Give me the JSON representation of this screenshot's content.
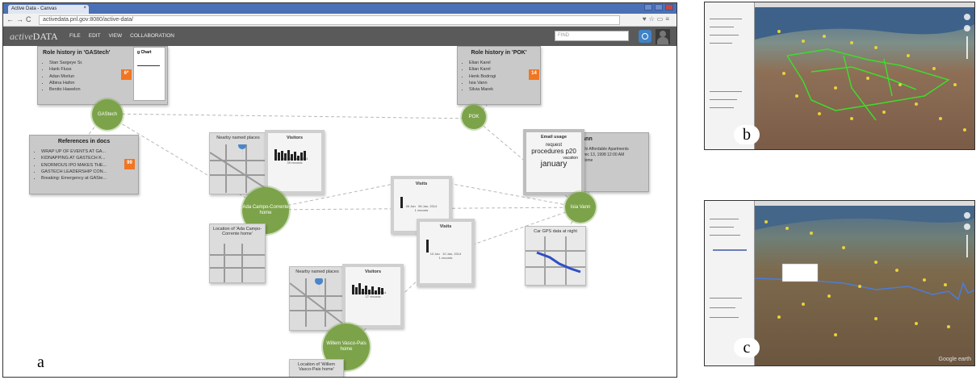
{
  "panel_a": {
    "label": "a",
    "browser": {
      "tab_title": "Active Data - Canvas",
      "url": "activedata.pnl.gov:8080/active-data/"
    },
    "app": {
      "logo_prefix": "active",
      "logo_suffix": "DATA",
      "menu": [
        "FILE",
        "EDIT",
        "VIEW",
        "COLLABORATION"
      ],
      "find_placeholder": "FIND"
    },
    "cards": {
      "role_gastech": {
        "title": "Role history in 'GAStech'",
        "items": [
          "Stan Sargeye Sr.",
          "Hank Fluss",
          "Adan Morlun",
          "Albina Hafon",
          "Benito Hawelon"
        ],
        "badge": "6*",
        "chart_title": "g Chart"
      },
      "role_pok": {
        "title": "Role history in 'POK'",
        "items": [
          "Elian Karel",
          "Elian Karel",
          "Henk Bodrogi",
          "Isia Vann",
          "Silvia Marek"
        ],
        "badge": "14"
      },
      "refs": {
        "title": "References in docs",
        "items": [
          "WRAP UP OF EVENTS AT GA...",
          "KIDNAPPING AT GASTECH K...",
          "ENORMOUS IPO MAKES THE...",
          "GASTECH LEADERSHIP CON...",
          "Breaking: Emergency at GASte..."
        ],
        "badge": "99"
      },
      "isia": {
        "title": "Vann",
        "lines": [
          "Ahi Affordable Apartments",
          "Dec 13, 1998 12:00 AM",
          "Home"
        ]
      }
    },
    "nodes": {
      "gastech": "GAStech",
      "pok": "POK",
      "ada": "Ada Campo-Corrente home",
      "isia": "Isia Vann",
      "willem": "Willem Vasco-Pais home"
    },
    "minis": {
      "nearby1": "Nearby named places",
      "visitors1": {
        "title": "Visitors",
        "axis": [
          "Jan",
          "13 Jan, 2014"
        ],
        "records": "39 records"
      },
      "location_ada": "Location of 'Ada Campo-Corrente home'",
      "visits1": {
        "title": "Visits",
        "axis": [
          "06 Jan",
          "06 Jan, 2014"
        ],
        "records": "1 records"
      },
      "visits2": {
        "title": "Visits",
        "axis": [
          "10 Jan",
          "10 Jan, 2014"
        ],
        "records": "1 records"
      },
      "email": {
        "title": "Email usage",
        "words": [
          "request",
          "procedures",
          "january",
          "vacation",
          "p20"
        ]
      },
      "cargps": "Car GPS data at night",
      "nearby2": "Nearby named places",
      "visitors2": {
        "title": "Visitors",
        "axis": [
          "Jan",
          "13 Jan, 2014"
        ],
        "records": "27 records"
      },
      "location_willem": "Location of 'Willem Vasco-Pais home'"
    }
  },
  "panel_b": {
    "label": "b"
  },
  "panel_c": {
    "label": "c",
    "watermark": "Google earth"
  },
  "colors": {
    "node_green": "#7ca34a",
    "badge_orange": "#f07622",
    "app_bar": "#5a5a5a",
    "track_green": "#39d02c",
    "track_blue": "#3b63d6"
  }
}
